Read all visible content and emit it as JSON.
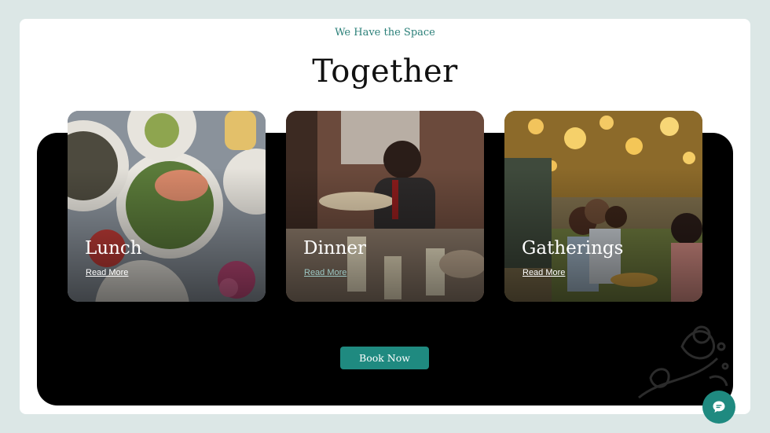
{
  "section": {
    "eyebrow": "We Have the Space",
    "title": "Together"
  },
  "cards": [
    {
      "title": "Lunch",
      "link": "Read More"
    },
    {
      "title": "Dinner",
      "link": "Read More"
    },
    {
      "title": "Gatherings",
      "link": "Read More"
    }
  ],
  "cta": {
    "label": "Book Now"
  },
  "icons": {
    "chat": "chat-bubble-icon",
    "decor": "floral-ornament-icon"
  },
  "colors": {
    "accent": "#1f8a80",
    "eyebrow": "#2a7f78",
    "page_bg": "#dce7e6",
    "panel_bg": "#000000"
  }
}
